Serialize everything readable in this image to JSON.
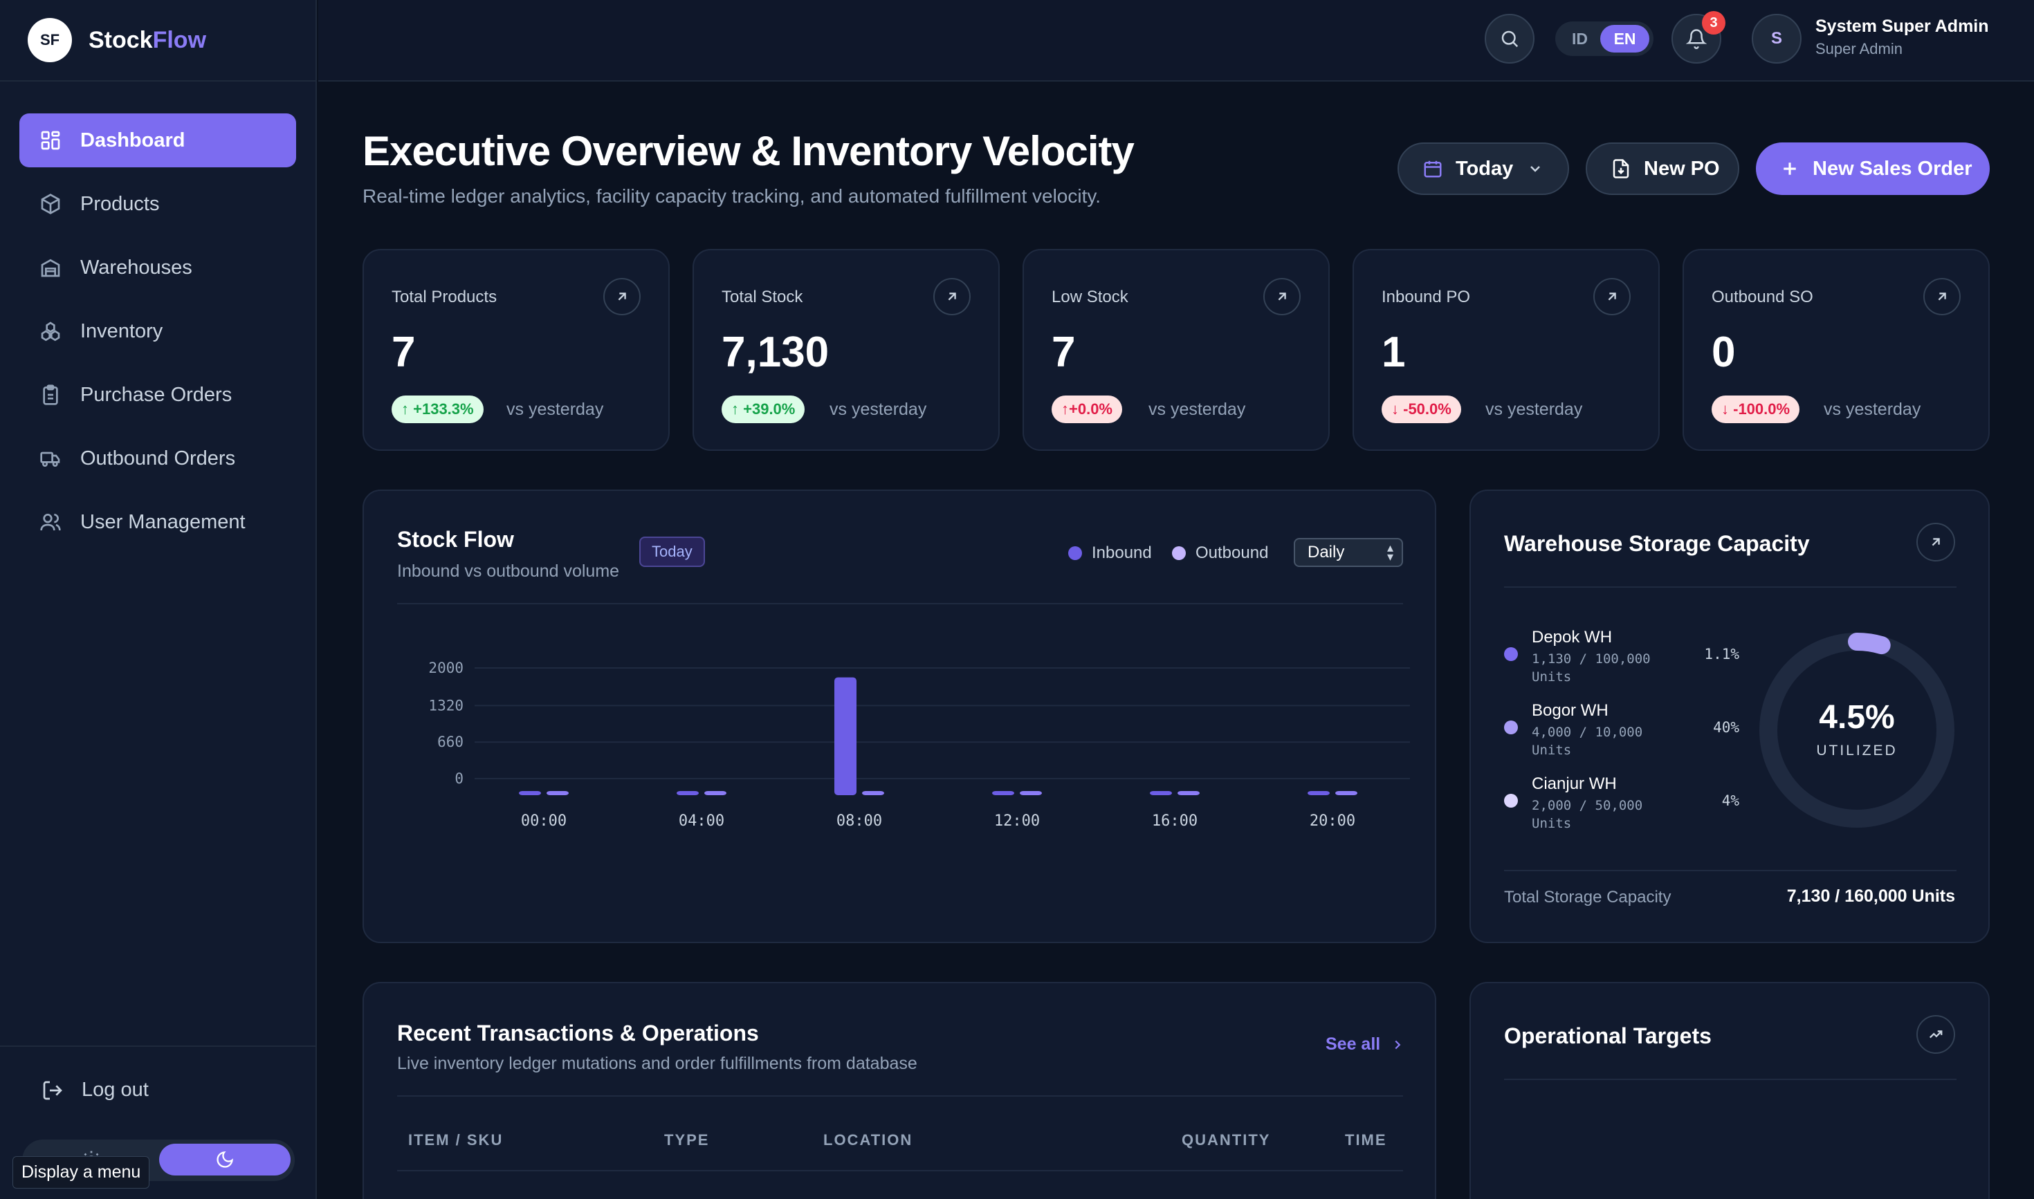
{
  "app": {
    "logo_initials": "SF",
    "name_part1": "Stock",
    "name_part2": "Flow",
    "accent_color": "#7c6cf0"
  },
  "sidebar": {
    "items": [
      {
        "label": "Dashboard",
        "icon": "dashboard-icon",
        "active": true
      },
      {
        "label": "Products",
        "icon": "box-icon"
      },
      {
        "label": "Warehouses",
        "icon": "warehouse-icon"
      },
      {
        "label": "Inventory",
        "icon": "boxes-icon"
      },
      {
        "label": "Purchase Orders",
        "icon": "clipboard-icon"
      },
      {
        "label": "Outbound Orders",
        "icon": "truck-icon"
      },
      {
        "label": "User Management",
        "icon": "users-icon"
      }
    ],
    "logout_label": "Log out",
    "theme": "dark",
    "tooltip": "Display a menu"
  },
  "topbar": {
    "lang_options": [
      "ID",
      "EN"
    ],
    "lang_selected": "EN",
    "notification_count": "3",
    "user_initial": "S",
    "user_name": "System Super Admin",
    "user_role": "Super Admin"
  },
  "header": {
    "title": "Executive Overview & Inventory Velocity",
    "subtitle": "Real-time ledger analytics, facility capacity tracking, and automated fulfillment velocity.",
    "date_filter": "Today",
    "new_po_label": "New PO",
    "new_so_label": "New Sales Order"
  },
  "stats": [
    {
      "title": "Total Products",
      "value": "7",
      "change": "+133.3%",
      "direction": "up",
      "note": "vs yesterday"
    },
    {
      "title": "Total Stock",
      "value": "7,130",
      "change": "+39.0%",
      "direction": "up",
      "note": "vs yesterday"
    },
    {
      "title": "Low Stock",
      "value": "7",
      "change": "+0.0%",
      "direction": "up-bad",
      "note": "vs yesterday"
    },
    {
      "title": "Inbound PO",
      "value": "1",
      "change": "-50.0%",
      "direction": "down",
      "note": "vs yesterday"
    },
    {
      "title": "Outbound SO",
      "value": "0",
      "change": "-100.0%",
      "direction": "down",
      "note": "vs yesterday"
    }
  ],
  "stock_flow": {
    "title": "Stock Flow",
    "subtitle": "Inbound vs outbound volume",
    "tag": "Today",
    "period": "Daily"
  },
  "chart_data": {
    "type": "bar",
    "categories": [
      "00:00",
      "04:00",
      "08:00",
      "12:00",
      "16:00",
      "20:00"
    ],
    "series": [
      {
        "name": "Inbound",
        "color": "#6d5ee6",
        "values": [
          0,
          0,
          2130,
          0,
          0,
          0
        ]
      },
      {
        "name": "Outbound",
        "color": "#8b7cf6",
        "values": [
          0,
          0,
          0,
          0,
          0,
          0
        ]
      }
    ],
    "yticks": [
      0,
      660,
      1320,
      2000
    ],
    "ylim": [
      0,
      2000
    ],
    "grid": true,
    "legend": "top-right"
  },
  "warehouse": {
    "title": "Warehouse Storage Capacity",
    "items": [
      {
        "name": "Depok WH",
        "detail": "1,130 / 100,000 Units",
        "pct": "1.1%",
        "color": "#7c6cf0"
      },
      {
        "name": "Bogor WH",
        "detail": "4,000 / 10,000 Units",
        "pct": "40%",
        "color": "#a89cf5"
      },
      {
        "name": "Cianjur WH",
        "detail": "2,000 / 50,000 Units",
        "pct": "4%",
        "color": "#ddd6fe"
      }
    ],
    "utilized_value": "4.5%",
    "utilized_fraction": 0.045,
    "utilized_label": "UTILIZED",
    "total_label": "Total Storage Capacity",
    "total_value": "7,130 / 160,000 Units"
  },
  "recent": {
    "title": "Recent Transactions & Operations",
    "subtitle": "Live inventory ledger mutations and order fulfillments from database",
    "see_all": "See all",
    "columns": [
      "ITEM / SKU",
      "TYPE",
      "LOCATION",
      "QUANTITY",
      "TIME"
    ]
  },
  "targets": {
    "title": "Operational Targets"
  }
}
